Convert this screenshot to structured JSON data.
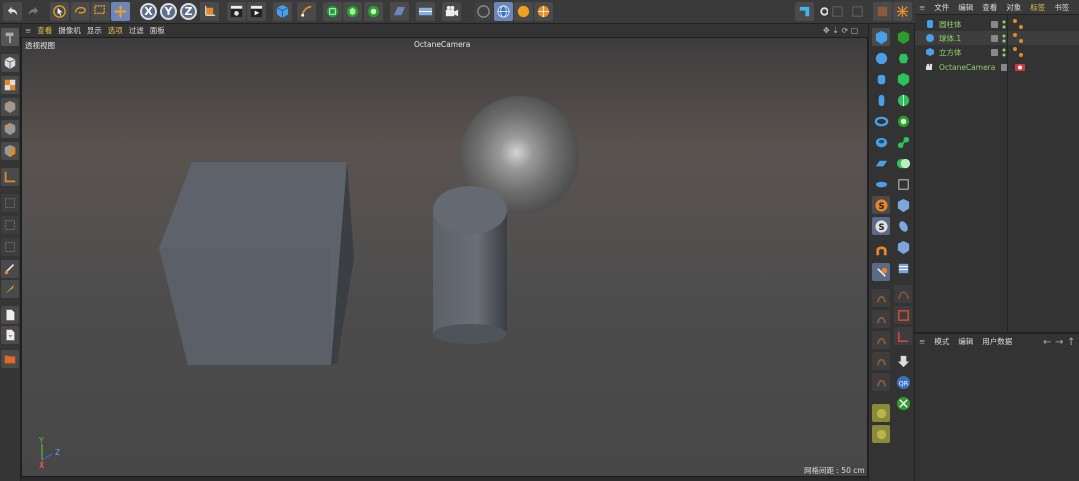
{
  "viewport_menu": [
    "查看",
    "摄像机",
    "显示",
    "选项",
    "过滤",
    "面板"
  ],
  "viewport_label": "透视视图",
  "camera_label": "OctaneCamera",
  "grid_spacing": "网格间距 : 50 cm",
  "axes": {
    "y": "Y",
    "x": "X",
    "z": "Z"
  },
  "xyz_buttons": [
    "X",
    "Y",
    "Z"
  ],
  "object_menu": [
    "文件",
    "编辑",
    "查看",
    "对象",
    "标签",
    "书签"
  ],
  "objects": [
    {
      "name": "圆柱体",
      "icon": "cylinder-icon"
    },
    {
      "name": "球体.1",
      "icon": "sphere-icon"
    },
    {
      "name": "立方体",
      "icon": "cube-icon"
    },
    {
      "name": "OctaneCamera",
      "icon": "camera-icon"
    }
  ],
  "attribute_menu": [
    "模式",
    "编辑",
    "用户数据"
  ],
  "colors": {
    "accent": "#e8c44a",
    "object_name": "#8fd16a",
    "selection": "#6a87b8"
  }
}
